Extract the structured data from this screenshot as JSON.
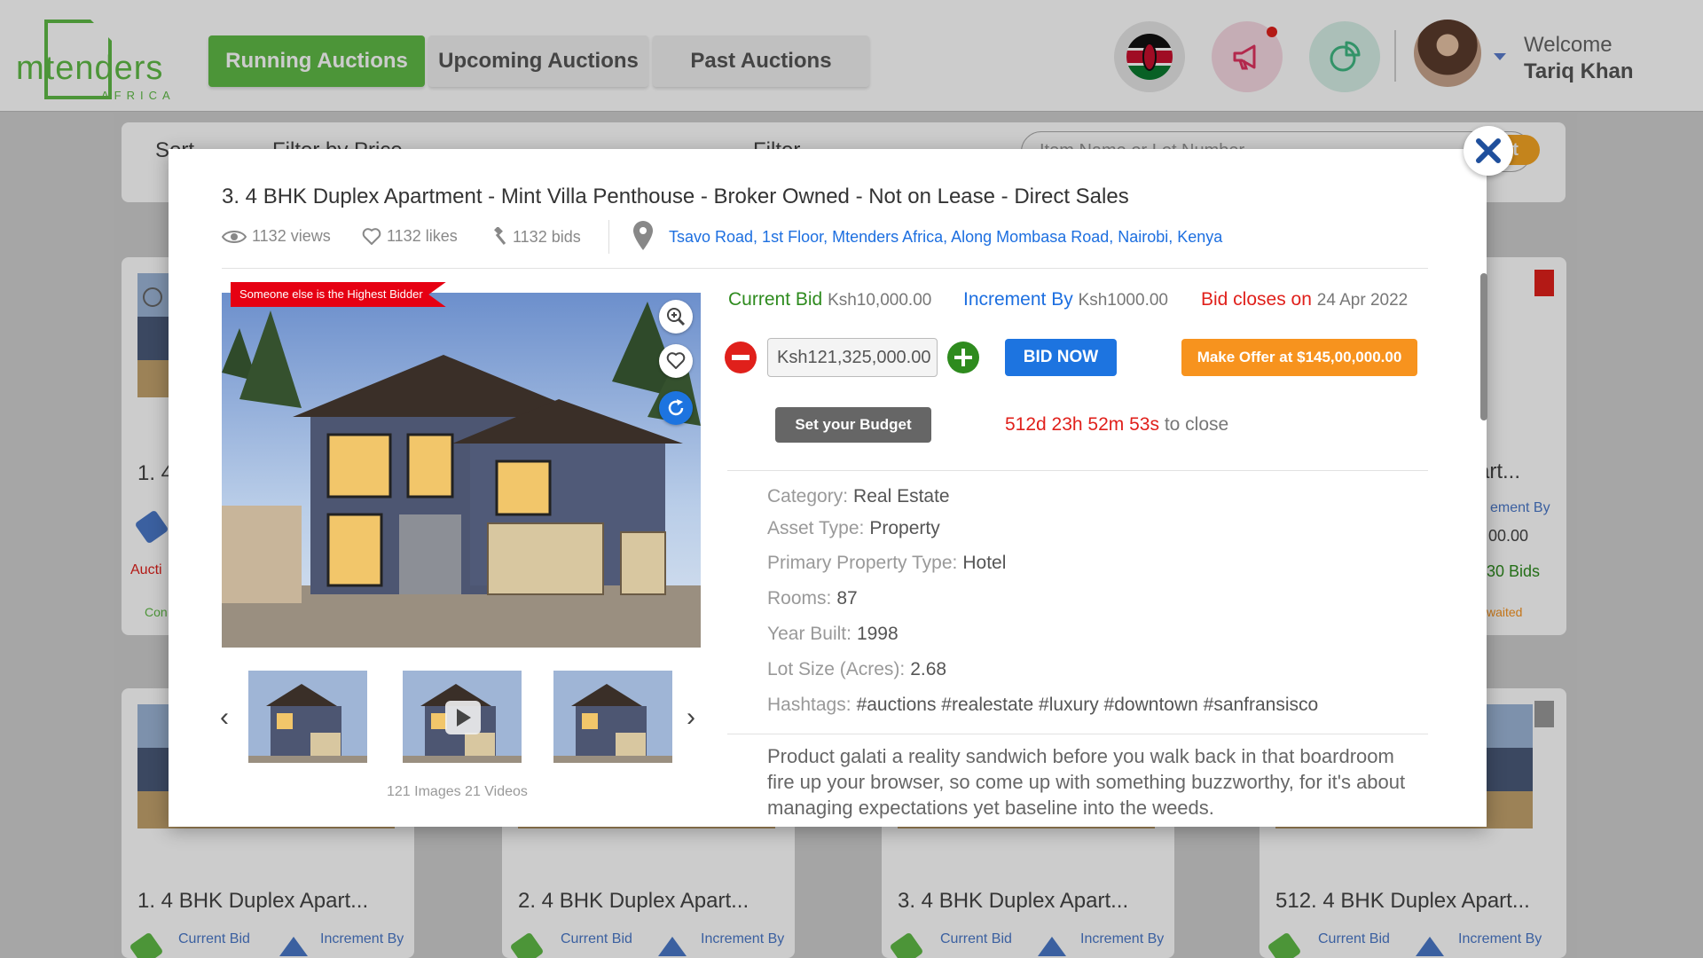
{
  "header": {
    "logo_text": "mtenders",
    "logo_sub": "AFRICA",
    "tabs": [
      {
        "label": "Running Auctions",
        "active": true
      },
      {
        "label": "Upcoming Auctions",
        "active": false
      },
      {
        "label": "Past Auctions",
        "active": false
      }
    ],
    "welcome_label": "Welcome",
    "user_name": "Tariq Khan",
    "accent": "#5fbb46"
  },
  "background": {
    "filter": {
      "sort_label": "Sort",
      "price_label": "Filter by Price",
      "filter_label": "Filter",
      "search_placeholder": "Item Name or Lot Number",
      "reset_label": "et"
    },
    "top_cards": [
      {
        "title": "1. 4",
        "status": "Aucti",
        "footer": "Con"
      },
      {
        "title": "art...",
        "increment_label": "ement By",
        "increment_value": "00.00",
        "bids": "30 Bids",
        "footer": "waited"
      }
    ],
    "bottom_cards": [
      {
        "title": "1. 4 BHK Duplex Apart...",
        "current_bid_label": "Current Bid",
        "increment_label": "Increment By"
      },
      {
        "title": "2. 4 BHK Duplex Apart...",
        "current_bid_label": "Current Bid",
        "increment_label": "Increment By"
      },
      {
        "title": "3. 4 BHK Duplex Apart...",
        "current_bid_label": "Current Bid",
        "increment_label": "Increment By"
      },
      {
        "title": "512. 4 BHK Duplex Apart...",
        "current_bid_label": "Current Bid",
        "increment_label": "Increment By"
      }
    ]
  },
  "modal": {
    "title": "3. 4 BHK Duplex Apartment - Mint Villa Penthouse - Broker Owned - Not on Lease - Direct Sales",
    "views": "1132 views",
    "likes": "1132 likes",
    "bids": "1132 bids",
    "address": "Tsavo Road, 1st Floor, Mtenders Africa, Along Mombasa Road, Nairobi, Kenya",
    "highest_bidder_badge": "Someone else is the Highest Bidder",
    "media_count": "121 Images 21 Videos",
    "current_bid_label": "Current Bid",
    "current_bid_value": "Ksh10,000.00",
    "increment_label": "Increment By",
    "increment_value": "Ksh1000.00",
    "closes_label": "Bid closes on",
    "closes_value": "24 Apr 2022",
    "bid_amount": "Ksh121,325,000.00",
    "bid_now_label": "BID NOW",
    "offer_label": "Make Offer at $145,00,000.00",
    "budget_label": "Set your Budget",
    "countdown_value": "512d 23h 52m 53s",
    "countdown_suffix": "to close",
    "specs": [
      {
        "key": "Category:",
        "value": "Real Estate"
      },
      {
        "key": "Asset Type:",
        "value": "Property"
      },
      {
        "key": "Primary Property Type:",
        "value": "Hotel"
      },
      {
        "key": "Rooms:",
        "value": "87"
      },
      {
        "key": "Year Built:",
        "value": "1998"
      },
      {
        "key": "Lot Size (Acres):",
        "value": "2.68"
      },
      {
        "key": "Hashtags:",
        "value": "#auctions #realestate #luxury #downtown #sanfransisco"
      }
    ],
    "description": "Product galati a reality sandwich before you walk back in that boardroom fire up your browser, so come up with something buzzworthy, for it's about managing expectations yet baseline into the weeds.",
    "colors": {
      "bid_green": "#2e8b1e",
      "link_blue": "#1d6fe0",
      "close_red": "#e0201b",
      "offer_orange": "#f7931e"
    }
  }
}
